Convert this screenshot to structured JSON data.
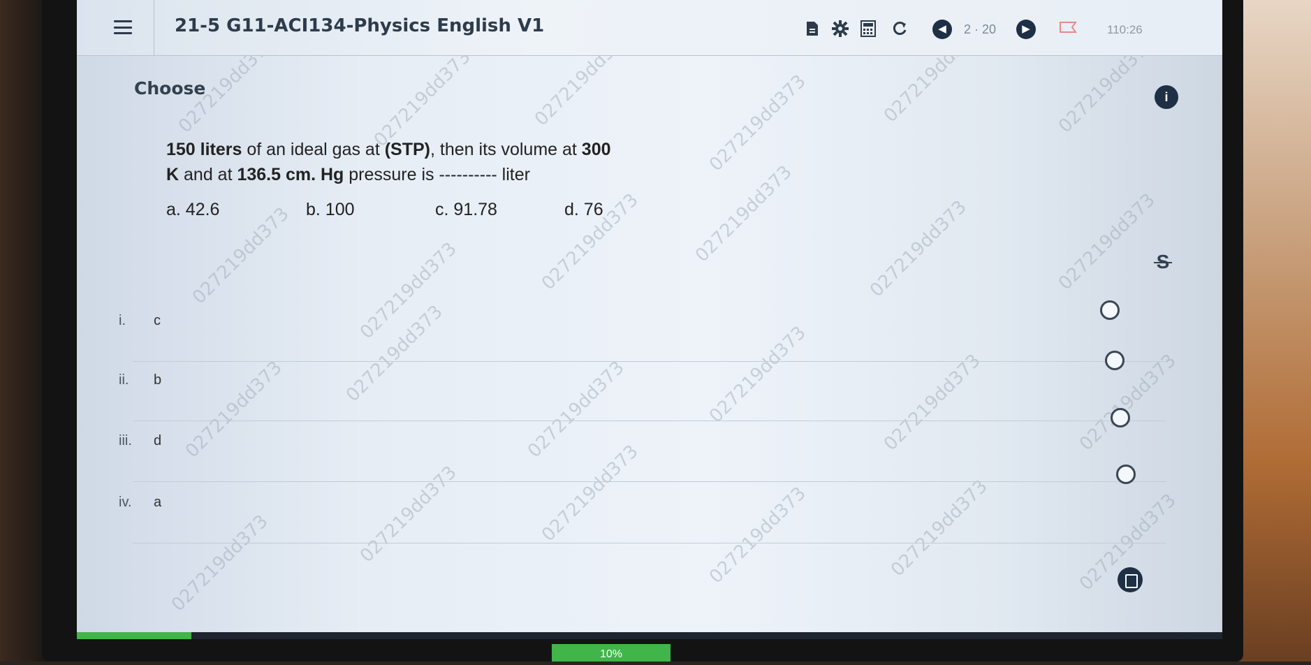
{
  "header": {
    "title": "21-5 G11-ACI134-Physics English V1",
    "page_counter": "2 · 20",
    "timer": "110:26"
  },
  "content": {
    "heading": "Choose",
    "info_badge": "i",
    "question": {
      "part1_bold": "150 liters",
      "part2": " of an ideal gas at ",
      "part3_bold": "(STP)",
      "part4": ", then its volume at ",
      "part5_bold": "300",
      "line2_part1_bold": "K",
      "line2_part2": " and at ",
      "line2_part3_bold": "136.5 cm. Hg",
      "line2_part4": " pressure is ---------- liter"
    },
    "inline_options": [
      "a. 42.6",
      "b. 100",
      "c. 91.78",
      "d. 76"
    ],
    "strike_tool": "S",
    "answers": [
      {
        "num": "i.",
        "text": "c"
      },
      {
        "num": "ii.",
        "text": "b"
      },
      {
        "num": "iii.",
        "text": "d"
      },
      {
        "num": "iv.",
        "text": "a"
      }
    ],
    "selected_answer": null
  },
  "footer": {
    "progress_label": "10%",
    "progress_value": 0.1
  },
  "watermark": "027219dd373",
  "colors": {
    "accent_dark": "#1e2f46",
    "progress": "#3fb54a"
  },
  "icons": [
    "menu-icon",
    "document-icon",
    "gear-icon",
    "calculator-icon",
    "refresh-icon",
    "prev-icon",
    "next-icon",
    "flag-icon",
    "info-icon",
    "strikethrough-icon",
    "calculator-fab-icon"
  ]
}
